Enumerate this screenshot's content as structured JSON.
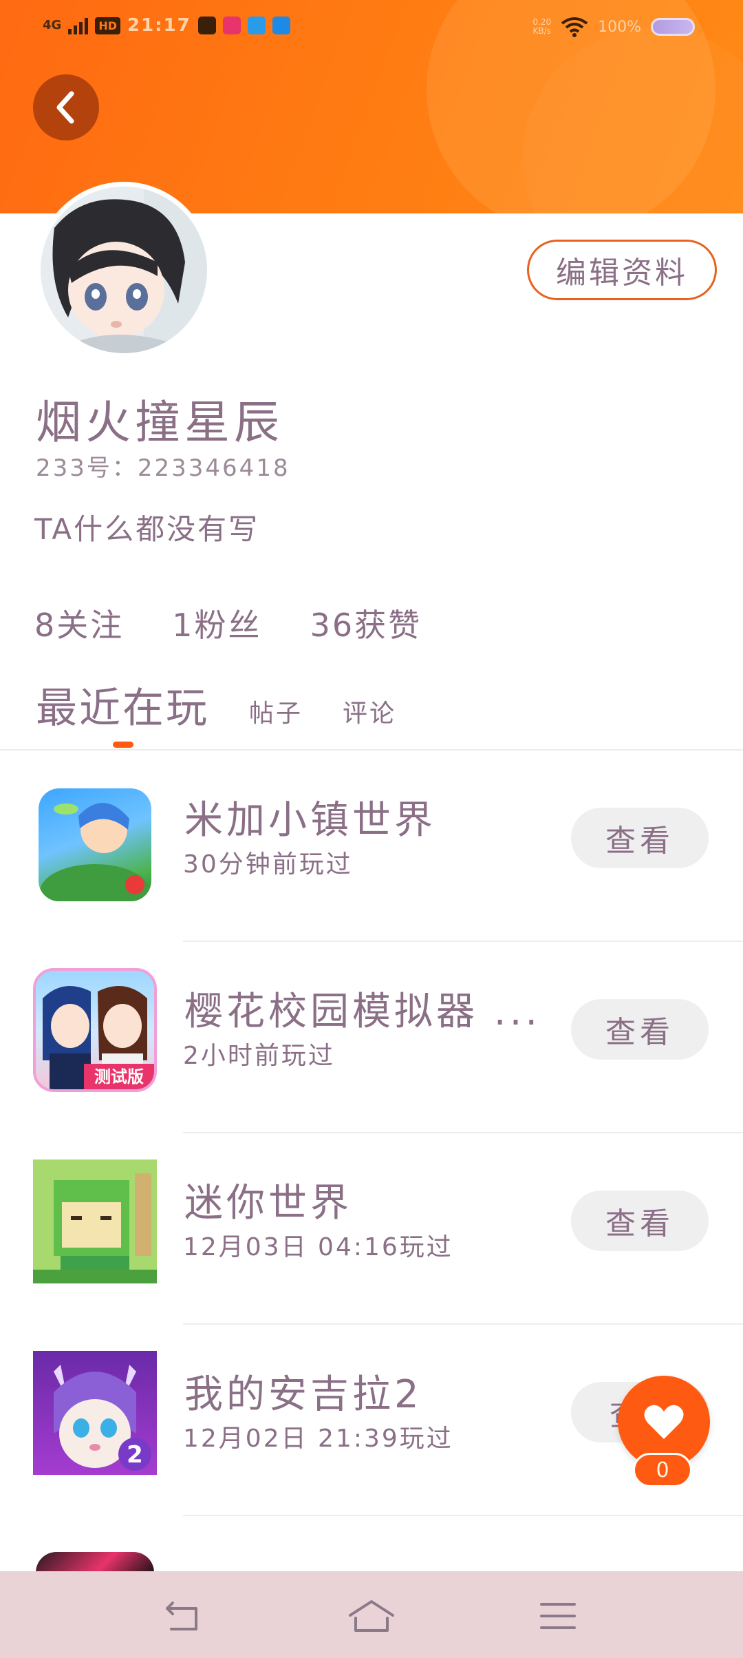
{
  "status_bar": {
    "network": "4G",
    "hd": "HD",
    "time": "21:17",
    "speed_top": "0.20",
    "speed_unit": "KB/s",
    "battery": "100%"
  },
  "profile": {
    "name": "烟火撞星辰",
    "uid": "233号：223346418",
    "bio": "TA什么都没有写",
    "edit_label": "编辑资料",
    "stats": {
      "following": "8关注",
      "fans": "1粉丝",
      "likes": "36获赞"
    }
  },
  "tabs": [
    {
      "label": "最近在玩",
      "active": true
    },
    {
      "label": "帖子",
      "active": false
    },
    {
      "label": "评论",
      "active": false
    }
  ],
  "games": [
    {
      "title": "米加小镇世界",
      "time": "30分钟前玩过",
      "button": "查看",
      "icon": "toca-world-icon"
    },
    {
      "title": "樱花校园模拟器 ...",
      "time": "2小时前玩过",
      "button": "查看",
      "icon": "sakura-school-icon"
    },
    {
      "title": "迷你世界",
      "time": "12月03日 04:16玩过",
      "button": "查看",
      "icon": "mini-world-icon"
    },
    {
      "title": "我的安吉拉2",
      "time": "12月02日 21:39玩过",
      "button": "查",
      "icon": "angela-icon"
    }
  ],
  "like_fab": {
    "count": "0"
  },
  "colors": {
    "header": "#ff7a12",
    "accent": "#ff5a10",
    "text": "#8a6f86",
    "navbar": "#ead3d7"
  }
}
